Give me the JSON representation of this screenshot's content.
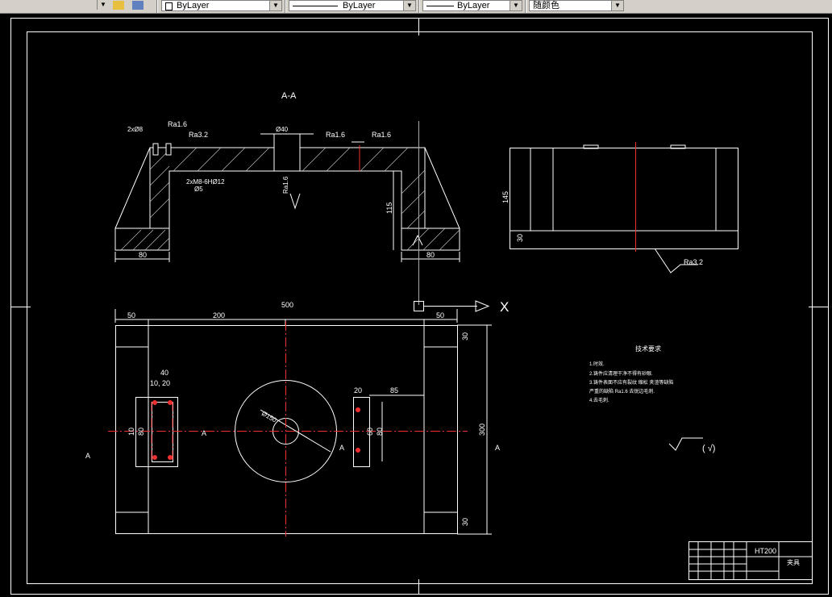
{
  "toolbar": {
    "layer_combo_value": "ByLayer",
    "linetype_combo_value": "ByLayer",
    "lineweight_combo_value": "ByLayer",
    "color_combo_value": "随颜色"
  },
  "drawing": {
    "section_label": "A-A",
    "roughness_1": "Ra1.6",
    "roughness_2": "Ra3.2",
    "roughness_3": "Ra1.6",
    "roughness_4": "Ra1.6",
    "roughness_side": "Ra1.6",
    "roughness_side_view": "Ra3.2",
    "callout_2x8": "2xØ8",
    "callout_hole": "Ø40",
    "callout_thread": "2xM8-6HØ12",
    "callout_thread_sub": "Ø5",
    "dim_80_left": "80",
    "dim_80_right": "80",
    "dim_115": "115",
    "dim_145": "145",
    "dim_30_side": "30",
    "dim_500": "500",
    "dim_50_left": "50",
    "dim_200": "200",
    "dim_50_right": "50",
    "dim_30_top": "30",
    "dim_300": "300",
    "dim_30_bottom": "30",
    "dim_40": "40",
    "dim_10_20": "10, 20",
    "dim_10": "10",
    "dim_80_v": "80",
    "dim_20": "20",
    "dim_85": "85",
    "dim_60": "60",
    "dim_80_v2": "80",
    "dim_diam": "Ø150",
    "section_mark_a1": "A",
    "section_mark_a2": "A",
    "section_mark_a3": "A",
    "section_mark_a4": "A",
    "axis_x_label": "X",
    "notes_title": "技术要求",
    "note_1": "1.时效.",
    "note_2": "2.铸件应清理干净不得有砂眼.",
    "note_3": "3.铸件表面不应有裂纹 缩松 夹渣等缺陷",
    "note_4": "严重的缺陷 Ra1.6 去锐边毛刺.",
    "note_5": "4.去毛刺.",
    "title_material": "HT200",
    "title_part": "夹具",
    "roughness_symbol_text": "( √)"
  }
}
